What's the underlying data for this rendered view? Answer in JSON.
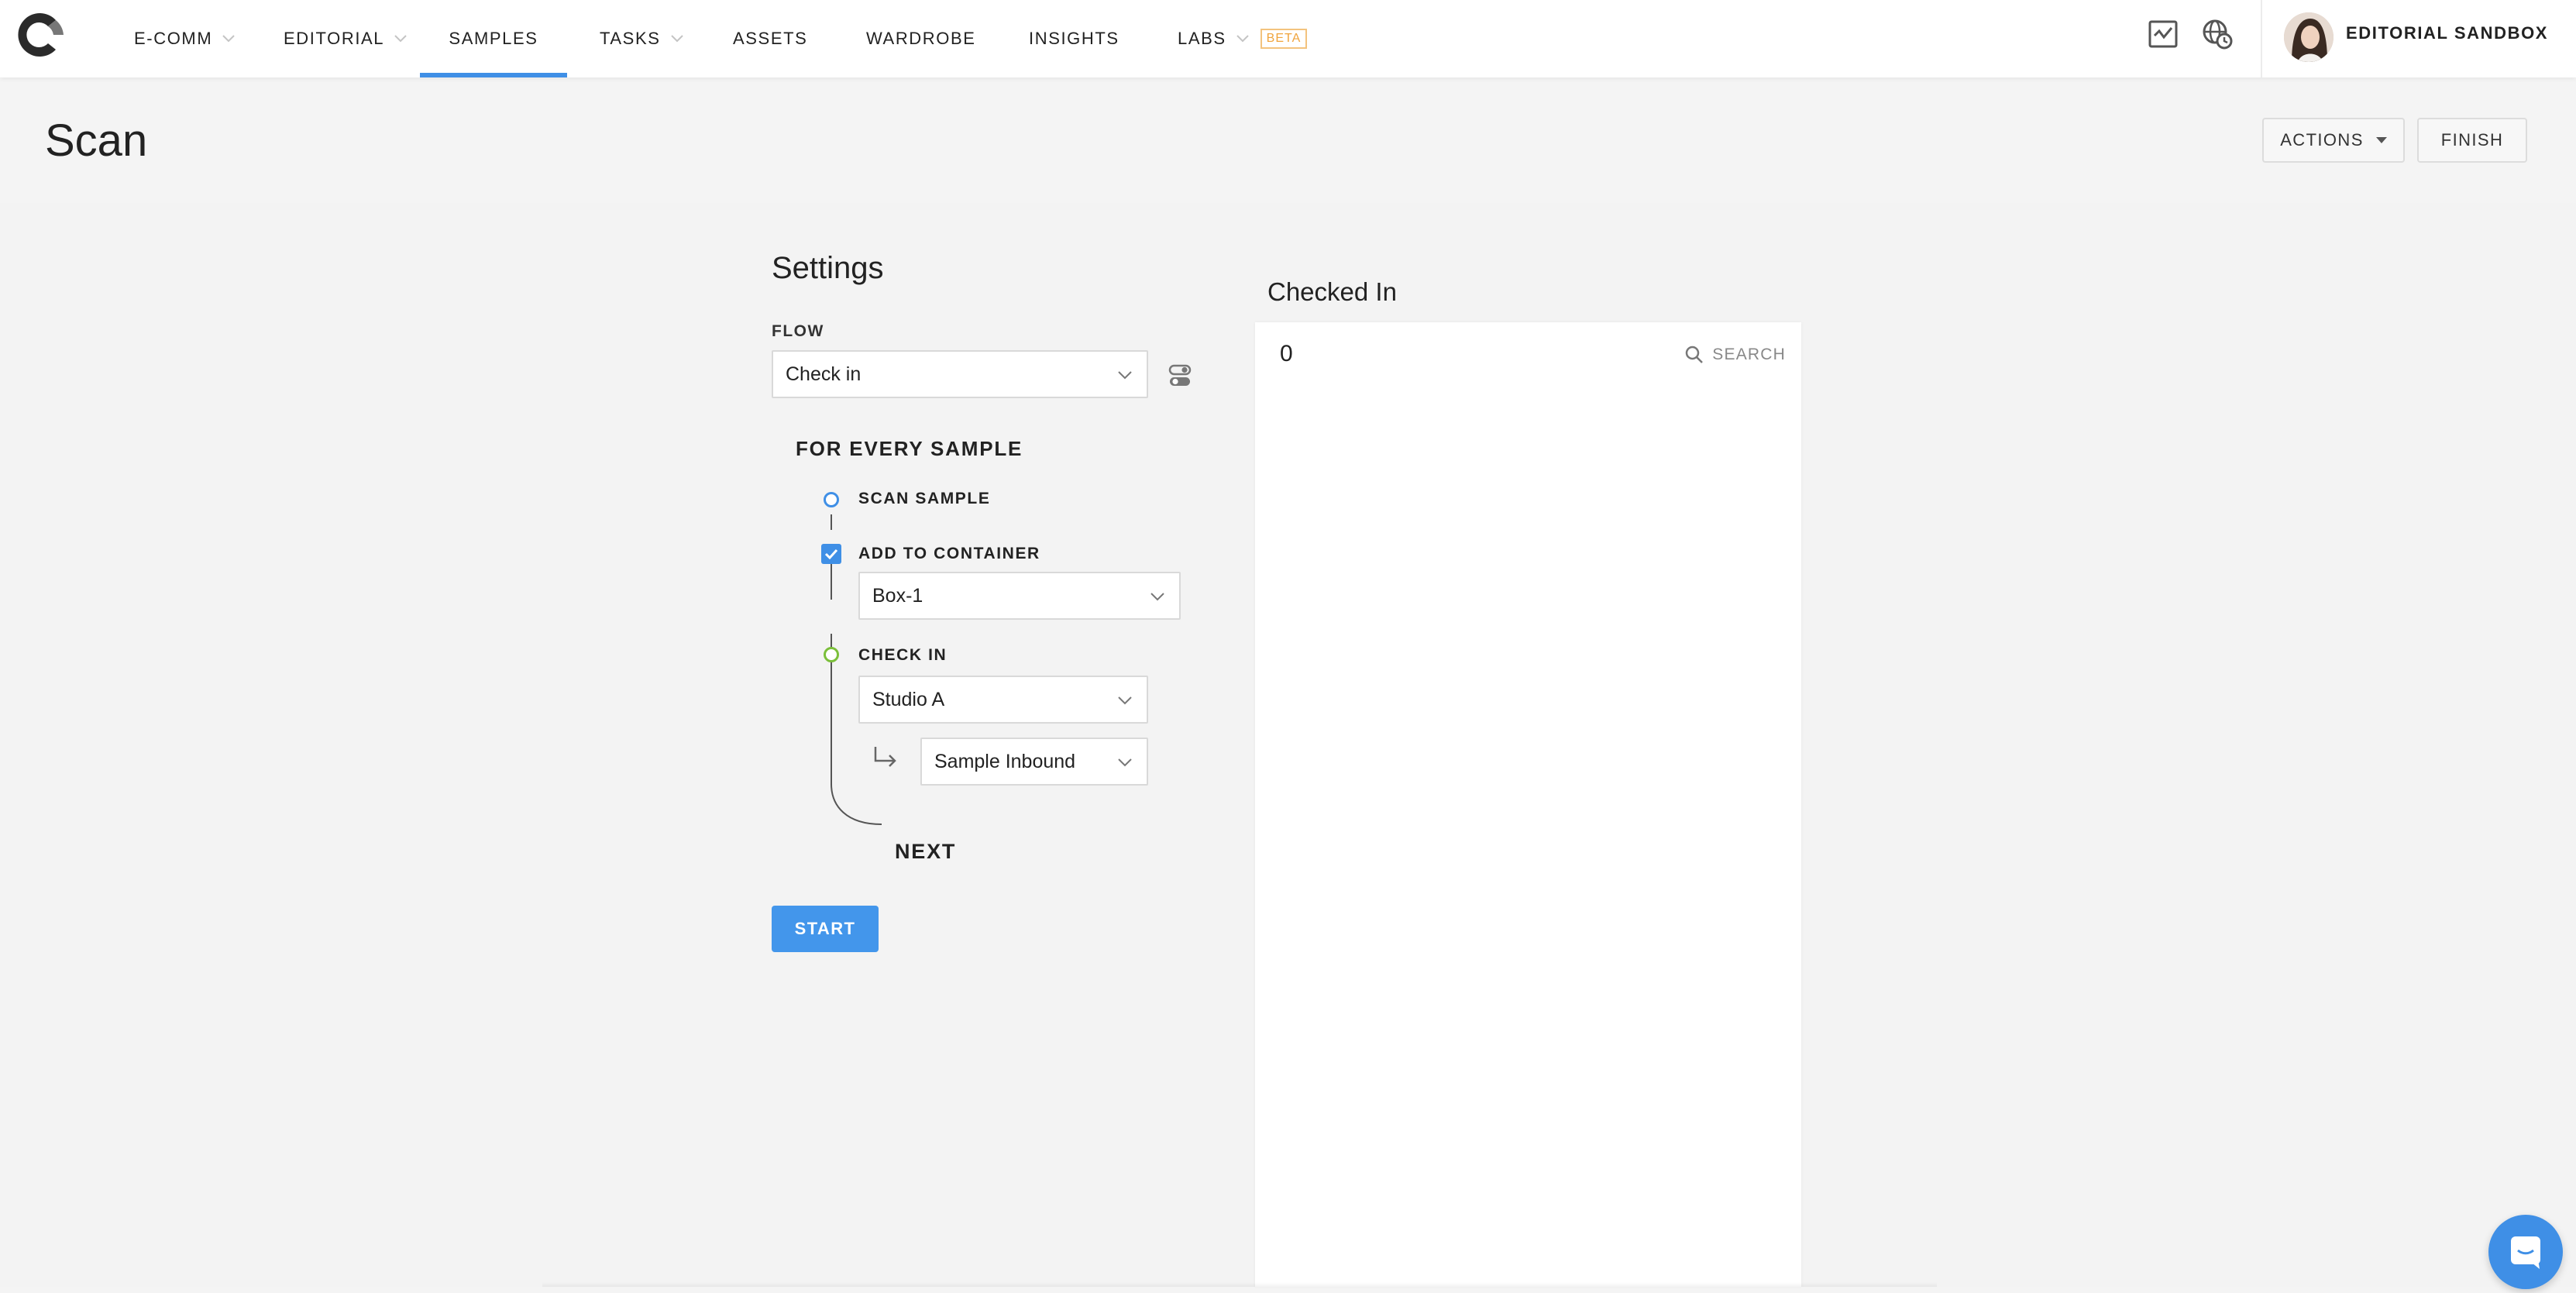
{
  "nav": {
    "items": [
      {
        "label": "E-COMM"
      },
      {
        "label": "EDITORIAL"
      },
      {
        "label": "SAMPLES"
      },
      {
        "label": "TASKS"
      },
      {
        "label": "ASSETS"
      },
      {
        "label": "WARDROBE"
      },
      {
        "label": "INSIGHTS"
      },
      {
        "label": "LABS",
        "badge": "BETA"
      }
    ],
    "active": "SAMPLES",
    "account": "EDITORIAL SANDBOX"
  },
  "header": {
    "title": "Scan",
    "actions_label": "ACTIONS",
    "finish_label": "FINISH"
  },
  "settings": {
    "title": "Settings",
    "flow_label": "FLOW",
    "flow_value": "Check in",
    "section_title": "FOR EVERY SAMPLE",
    "steps": {
      "scan": "SCAN SAMPLE",
      "container": "ADD TO CONTAINER",
      "container_value": "Box-1",
      "container_checked": true,
      "checkin": "CHECK IN",
      "location_value": "Studio A",
      "sublocation_value": "Sample Inbound",
      "next": "NEXT"
    },
    "start_label": "START"
  },
  "panel": {
    "title": "Checked In",
    "count": "0",
    "search_label": "SEARCH"
  },
  "colors": {
    "accent": "#3f8fe6",
    "beta": "#f0a43c",
    "checkin_ring": "#7bbf3a"
  }
}
